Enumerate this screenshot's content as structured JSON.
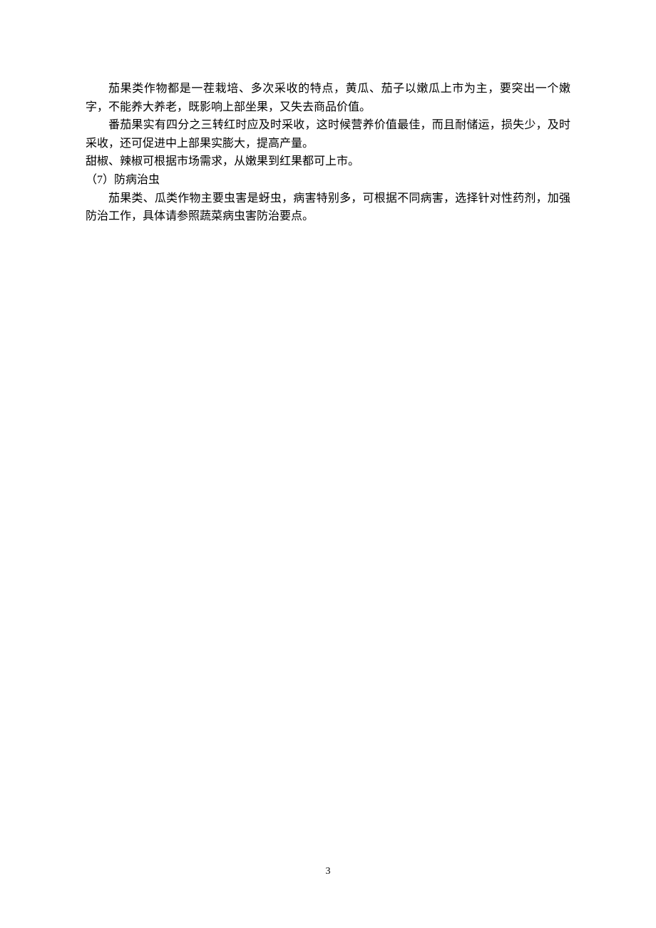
{
  "content": {
    "p1": "茄果类作物都是一茬栽培、多次采收的特点，黄瓜、茄子以嫩瓜上市为主，要突出一个嫩字，不能养大养老，既影响上部坐果，又失去商品价值。",
    "p2": "番茄果实有四分之三转红时应及时采收，这时候营养价值最佳，而且耐储运，损失少，及时采收，还可促进中上部果实膨大，提高产量。",
    "p3": "甜椒、辣椒可根据市场需求，从嫩果到红果都可上市。",
    "section_heading": "（7）防病治虫",
    "p4": "茄果类、瓜类作物主要虫害是蚜虫，病害特别多，可根据不同病害，选择针对性药剂，加强防治工作，具体请参照蔬菜病虫害防治要点。"
  },
  "page_number": "3"
}
